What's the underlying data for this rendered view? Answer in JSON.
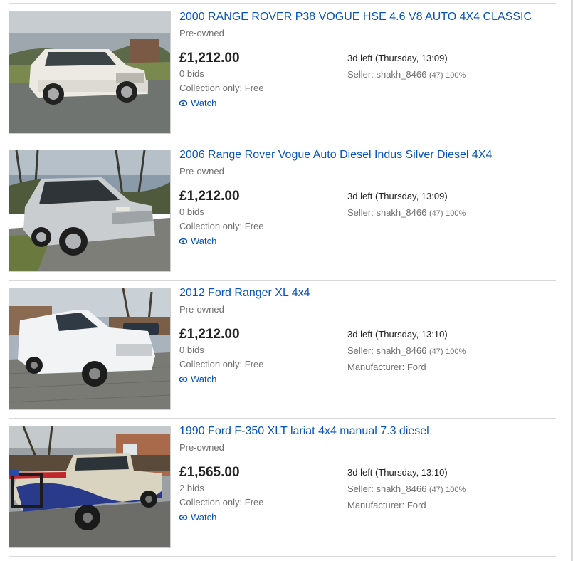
{
  "listings": [
    {
      "title": "2000 RANGE ROVER P38 VOGUE HSE 4.6 V8 AUTO 4X4 CLASSIC",
      "condition": "Pre-owned",
      "price": "£1,212.00",
      "bids": "0 bids",
      "shipping": "Collection only: Free",
      "watch_label": "Watch",
      "time_left": "3d left (Thursday, 13:09)",
      "seller_prefix": "Seller: ",
      "seller_name": "shakh_8466",
      "seller_feedback": "(47)",
      "seller_percent": "100%",
      "manufacturer": "",
      "image_icon": "white-range-rover-photo"
    },
    {
      "title": "2006 Range Rover Vogue Auto Diesel Indus Silver Diesel 4X4",
      "condition": "Pre-owned",
      "price": "£1,212.00",
      "bids": "0 bids",
      "shipping": "Collection only: Free",
      "watch_label": "Watch",
      "time_left": "3d left (Thursday, 13:09)",
      "seller_prefix": "Seller: ",
      "seller_name": "shakh_8466",
      "seller_feedback": "(47)",
      "seller_percent": "100%",
      "manufacturer": "",
      "image_icon": "silver-range-rover-photo"
    },
    {
      "title": "2012 Ford Ranger XL 4x4",
      "condition": "Pre-owned",
      "price": "£1,212.00",
      "bids": "0 bids",
      "shipping": "Collection only: Free",
      "watch_label": "Watch",
      "time_left": "3d left (Thursday, 13:10)",
      "seller_prefix": "Seller: ",
      "seller_name": "shakh_8466",
      "seller_feedback": "(47)",
      "seller_percent": "100%",
      "manufacturer": "Manufacturer: Ford",
      "image_icon": "white-ford-ranger-photo"
    },
    {
      "title": "1990 Ford F-350 XLT lariat 4x4 manual 7.3 diesel",
      "condition": "Pre-owned",
      "price": "£1,565.00",
      "bids": "2 bids",
      "shipping": "Collection only: Free",
      "watch_label": "Watch",
      "time_left": "3d left (Thursday, 13:10)",
      "seller_prefix": "Seller: ",
      "seller_name": "shakh_8466",
      "seller_feedback": "(47)",
      "seller_percent": "100%",
      "manufacturer": "Manufacturer: Ford",
      "image_icon": "ford-f350-pickup-photo"
    }
  ],
  "colors": {
    "link": "#0654ba",
    "secondary_text": "#707070",
    "price": "#222222",
    "divider": "#d8d8d8"
  }
}
